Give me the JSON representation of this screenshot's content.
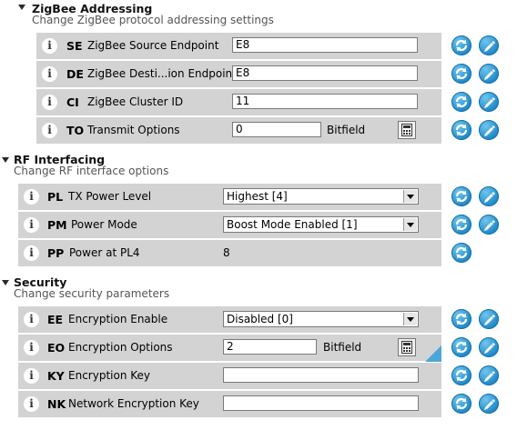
{
  "sections": {
    "zigbee": {
      "title": "ZigBee Addressing",
      "subtitle": "Change ZigBee protocol addressing settings",
      "rows": [
        {
          "code": "SE",
          "label": "ZigBee Source Endpoint",
          "value": "E8"
        },
        {
          "code": "DE",
          "label": "ZigBee Desti...ion Endpoint",
          "value": "E8"
        },
        {
          "code": "CI",
          "label": "ZigBee Cluster ID",
          "value": "11"
        },
        {
          "code": "TO",
          "label": "Transmit Options",
          "value": "0",
          "suffix": "Bitfield"
        }
      ]
    },
    "rf": {
      "title": "RF Interfacing",
      "subtitle": "Change RF interface options",
      "rows": [
        {
          "code": "PL",
          "label": "TX Power Level",
          "value": "Highest [4]"
        },
        {
          "code": "PM",
          "label": "Power Mode",
          "value": "Boost Mode Enabled [1]"
        },
        {
          "code": "PP",
          "label": "Power at PL4",
          "value": "8"
        }
      ]
    },
    "security": {
      "title": "Security",
      "subtitle": "Change security parameters",
      "rows": [
        {
          "code": "EE",
          "label": "Encryption Enable",
          "value": "Disabled [0]"
        },
        {
          "code": "EO",
          "label": "Encryption Options",
          "value": "2",
          "suffix": "Bitfield"
        },
        {
          "code": "KY",
          "label": "Encryption Key",
          "value": ""
        },
        {
          "code": "NK",
          "label": "Network Encryption Key",
          "value": ""
        }
      ]
    }
  },
  "info_glyph": "i",
  "colors": {
    "row_bg": "#d3d3d3",
    "button_blue": "#1e88c9",
    "corner_accent": "#4ea6d6"
  },
  "icons": {
    "read": "refresh-icon",
    "write": "pencil-icon",
    "calculator": "calculator-icon",
    "info": "info-icon"
  }
}
